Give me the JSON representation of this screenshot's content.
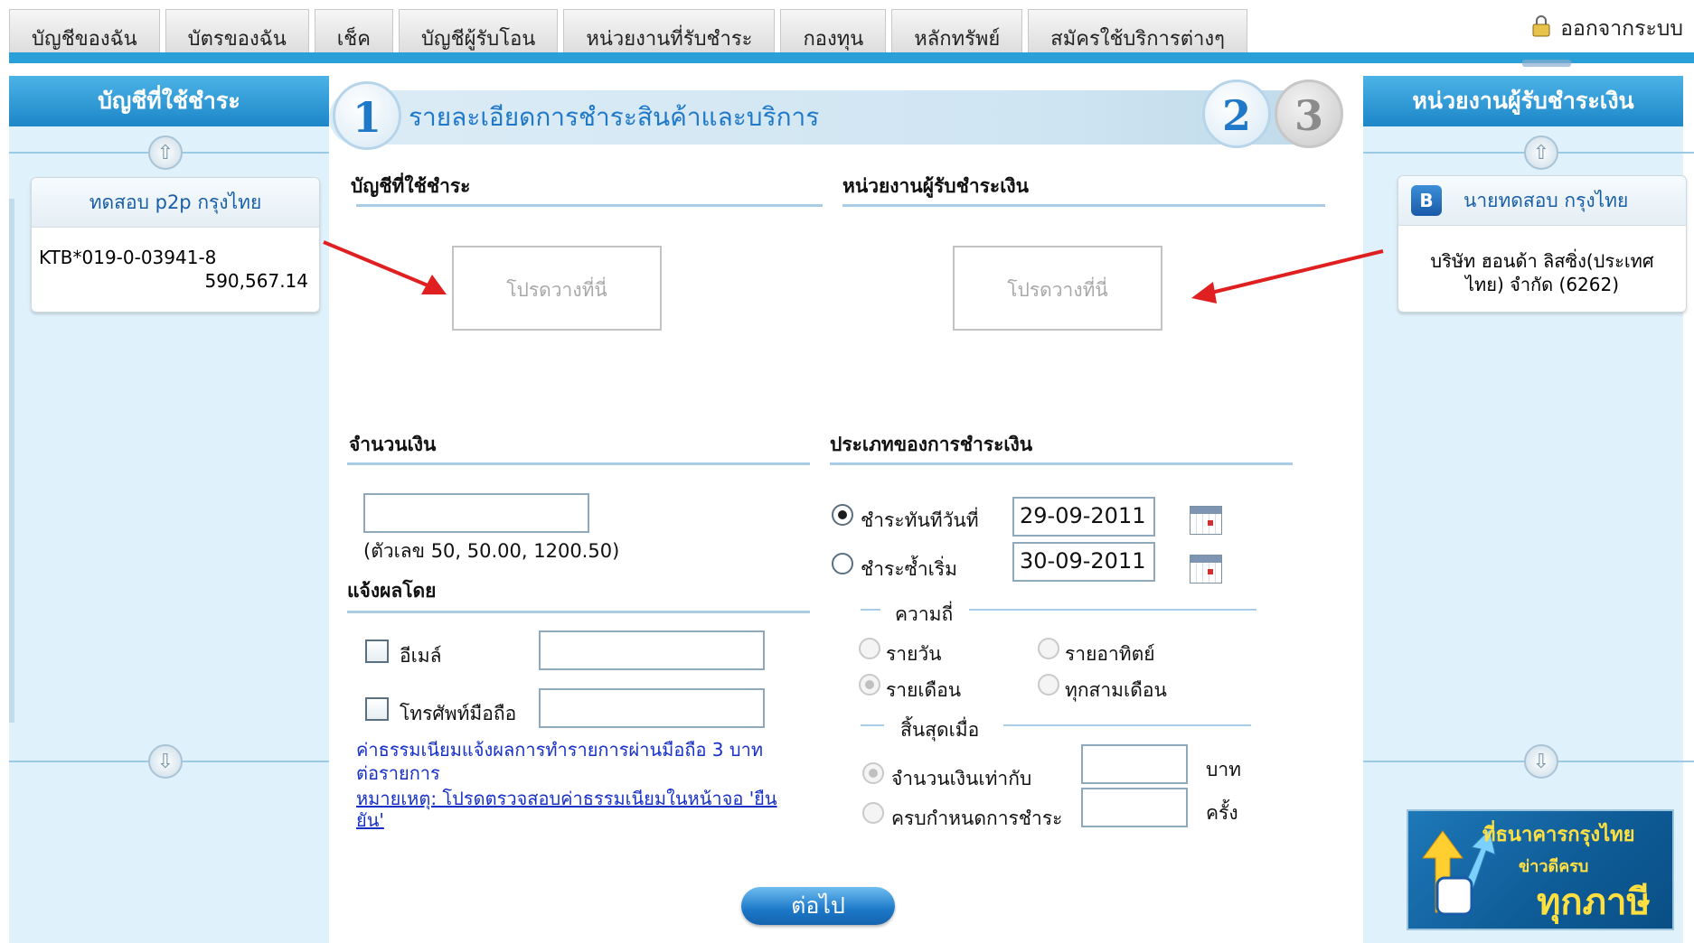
{
  "nav": {
    "tabs": [
      "บัญชีของฉัน",
      "บัตรของฉัน",
      "เช็ค",
      "บัญชีผู้รับโอน",
      "หน่วยงานที่รับชำระ",
      "กองทุน",
      "หลักทรัพย์",
      "สมัครใช้บริการต่างๆ"
    ],
    "logout": "ออกจากระบบ"
  },
  "left": {
    "title": "บัญชีที่ใช้ชำระ",
    "card_header": "ทดสอบ p2p กรุงไทย",
    "account_no": "KTB*019-0-03941-8",
    "balance": "590,567.14"
  },
  "right": {
    "title": "หน่วยงานผู้รับชำระเงิน",
    "card_header": "นายทดสอบ กรุงไทย",
    "payee_line1": "บริษัท ฮอนด้า ลิสซิ่ง(ประเทศ",
    "payee_line2": "ไทย) จำกัด (6262)",
    "banner_line1": "ที่ธนาคารกรุงไทย",
    "banner_line2": "ข่าวดีครบ",
    "banner_line3": "ทุกภาษี"
  },
  "main": {
    "steps": [
      "1",
      "2",
      "3"
    ],
    "step_title": "รายละเอียดการชำระสินค้าและบริการ",
    "from_account_title": "บัญชีที่ใช้ชำระ",
    "payee_title": "หน่วยงานผู้รับชำระเงิน",
    "drop_here": "โปรดวางที่นี่",
    "amount_title": "จำนวนเงิน",
    "amount_value": "",
    "amount_hint": "(ตัวเลข 50, 50.00, 1200.50)",
    "notify_title": "แจ้งผลโดย",
    "email_label": "อีเมล์",
    "mobile_label": "โทรศัพท์มือถือ",
    "fee_line1": "ค่าธรรมเนียมแจ้งผลการทำรายการผ่านมือถือ 3 บาท",
    "fee_line2": "ต่อรายการ",
    "note_line1": "หมายเหตุ: โปรดตรวจสอบค่าธรรมเนียมในหน้าจอ 'ยืน",
    "note_line2": "ยัน'",
    "payment_type_title": "ประเภทของการชำระเงิน",
    "pay_now_label": "ชำระทันทีวันที่",
    "pay_now_date": "29-09-2011",
    "pay_repeat_label": "ชำระซ้ำเริ่ม",
    "pay_repeat_date": "30-09-2011",
    "frequency_title": "ความถี่",
    "freq_daily": "รายวัน",
    "freq_weekly": "รายอาทิตย์",
    "freq_monthly": "รายเดือน",
    "freq_quarterly": "ทุกสามเดือน",
    "end_title": "สิ้นสุดเมื่อ",
    "end_amount_label": "จำนวนเงินเท่ากับ",
    "end_amount_unit": "บาท",
    "end_count_label": "ครบกำหนดการชำระ",
    "end_count_unit": "ครั้ง",
    "next_button": "ต่อไป"
  },
  "colors": {
    "accent": "#1f78c8",
    "panel": "#dff1fa",
    "arrow": "#e02020"
  }
}
